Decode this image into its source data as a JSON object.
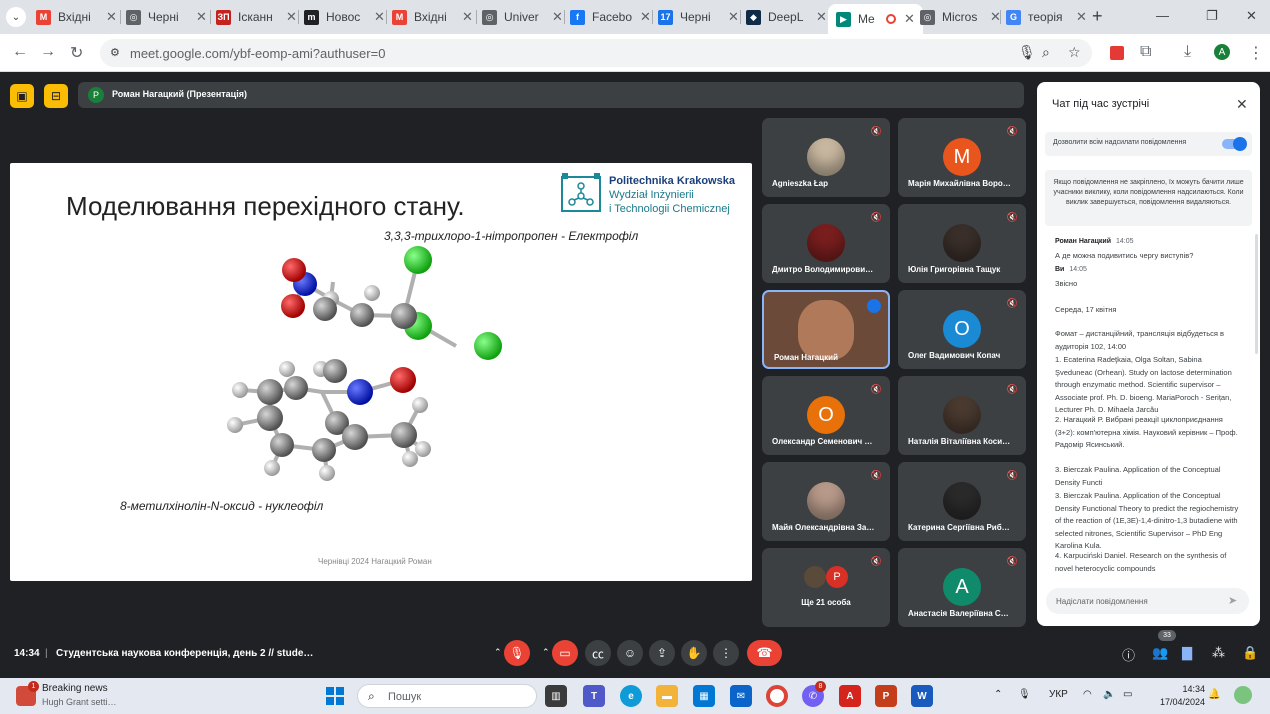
{
  "browser": {
    "tabs": [
      {
        "title": "Вхідні",
        "icon": "gmail-icon",
        "color": "#ea4335"
      },
      {
        "title": "Черні",
        "icon": "globe-icon",
        "color": "#5f6368"
      },
      {
        "title": "Ісканн",
        "icon": "iskan-icon",
        "color": "#c5221f"
      },
      {
        "title": "Новос",
        "icon": "m-icon",
        "color": "#202124"
      },
      {
        "title": "Вхідні",
        "icon": "gmail-icon",
        "color": "#ea4335"
      },
      {
        "title": "Univer",
        "icon": "globe-icon",
        "color": "#5f6368"
      },
      {
        "title": "Facebo",
        "icon": "facebook-icon",
        "color": "#1877f2"
      },
      {
        "title": "Черні",
        "icon": "calendar-icon",
        "color": "#1a73e8"
      },
      {
        "title": "DeepL",
        "icon": "deepl-icon",
        "color": "#0f2b46"
      },
      {
        "title": "Me",
        "icon": "meet-icon",
        "color": "#00897b",
        "active": true
      },
      {
        "title": "Micros",
        "icon": "globe-icon",
        "color": "#5f6368"
      },
      {
        "title": "теорія",
        "icon": "google-icon",
        "color": "#4285f4"
      }
    ],
    "url": "meet.google.com/ybf-eomp-ami?authuser=0",
    "profile_initial": "A"
  },
  "presenter": {
    "avatar": "Р",
    "label": "Роман Нагацкий (Презентація)"
  },
  "slide": {
    "title": "Моделювання перехідного стану.",
    "subtitle_top": "3,3,3-трихлоро-1-нітропропен - Електрофіл",
    "subtitle_bottom": "8-метилхінолін-N-оксид - нуклеофіл",
    "footer": "Чернівці 2024 Нагацкий Роман",
    "logo_line1": "Politechnika Krakowska",
    "logo_line2": "Wydział Inżynierii",
    "logo_line3": "i Technologii Chemicznej"
  },
  "participants": [
    {
      "name": "Agnieszka Łap",
      "avatar": "",
      "color": "#c9b8a0",
      "photo": true
    },
    {
      "name": "Марія Михайлівна Воро…",
      "avatar": "М",
      "color": "#e8561e"
    },
    {
      "name": "Дмитро Володимирови…",
      "avatar": "",
      "color": "#7a1e1e",
      "photo": true
    },
    {
      "name": "Юлія Григорівна Тащук",
      "avatar": "",
      "color": "#3a2f2a",
      "photo": true
    },
    {
      "name": "Роман Нагацкий",
      "avatar": "",
      "color": "#6b4a3a",
      "speaking": true
    },
    {
      "name": "Олег Вадимович Копач",
      "avatar": "О",
      "color": "#1a8ad4"
    },
    {
      "name": "Олександр Семенович …",
      "avatar": "О",
      "color": "#e8710a"
    },
    {
      "name": "Наталія Віталіївна Коси…",
      "avatar": "",
      "color": "#4a3a30",
      "photo": true
    },
    {
      "name": "Майя Олександрівна За…",
      "avatar": "",
      "color": "#b89a8a",
      "photo": true
    },
    {
      "name": "Катерина Сергіївна Риб…",
      "avatar": "",
      "color": "#2a2a2a",
      "photo": true
    },
    {
      "name": "Ще 21 особа",
      "avatar": "Р",
      "color": "#d93025"
    },
    {
      "name": "Анастасія Валеріївна С…",
      "avatar": "А",
      "color": "#0f8a6a"
    }
  ],
  "chat": {
    "title": "Чат під час зустрічі",
    "allow_label": "Дозволити всім надсилати повідомлення",
    "note": "Якщо повідомлення не закріплено, їх можуть бачити лише учасники виклику, коли повідомлення надсилаються. Коли виклик завершується, повідомлення видаляються.",
    "messages": [
      {
        "sender": "Роман Нагацкий",
        "time": "14:05",
        "text": "А де можна подивитись чергу виступів?"
      },
      {
        "sender": "Ви",
        "time": "14:05",
        "text": "Звісно"
      },
      {
        "sender": "",
        "time": "",
        "text": "Середа, 17 квітня"
      },
      {
        "sender": "",
        "time": "",
        "text": "Фомат – дистанційний, трансляція відбудеться в аудиторія 102, 14:00"
      },
      {
        "sender": "",
        "time": "",
        "text": "1. Ecaterina Radeţkaia, Olga Soltan, Sabina Şveduneac (Orhean). Study on lactose determination through enzymatic method. Scientific supervisor – Associate prof. Ph. D. bioeng. MariaPoroch - Serițan, Lecturer Ph. D. Mihaela Jarcău"
      },
      {
        "sender": "",
        "time": "",
        "text": "2. Нагацкий Р. Вибрані реакції циклоприєднання (3+2): комп'ютерна хімія. Науковий керівник – Проф. Радомір Ясинський."
      },
      {
        "sender": "",
        "time": "",
        "text": "3. Bierczak Paulina. Application of the Conceptual Density Functi"
      },
      {
        "sender": "",
        "time": "",
        "text": "3. Bierczak Paulina. Application of the Conceptual Density Functional Theory to predict the regiochemistry of the reaction of (1E,3E)-1,4-dinitro-1,3 butadiene with selected nitrones, Scientific Supervisor – PhD Eng Karolina Kula."
      },
      {
        "sender": "",
        "time": "",
        "text": "4. Karpuciński Daniel. Research on the synthesis of novel heterocyclic compounds"
      }
    ],
    "input_placeholder": "Надіслати повідомлення"
  },
  "meetbar": {
    "time": "14:34",
    "separator": "|",
    "meeting_name": "Студентська наукова конференція, день 2 // stude…",
    "people_count": "33"
  },
  "taskbar": {
    "news_badge": "1",
    "news_title": "Breaking news",
    "news_sub": "Hugh Grant setti…",
    "search_label": "Пошук",
    "viber_badge": "8",
    "language": "УКР",
    "time": "14:34",
    "date": "17/04/2024"
  }
}
